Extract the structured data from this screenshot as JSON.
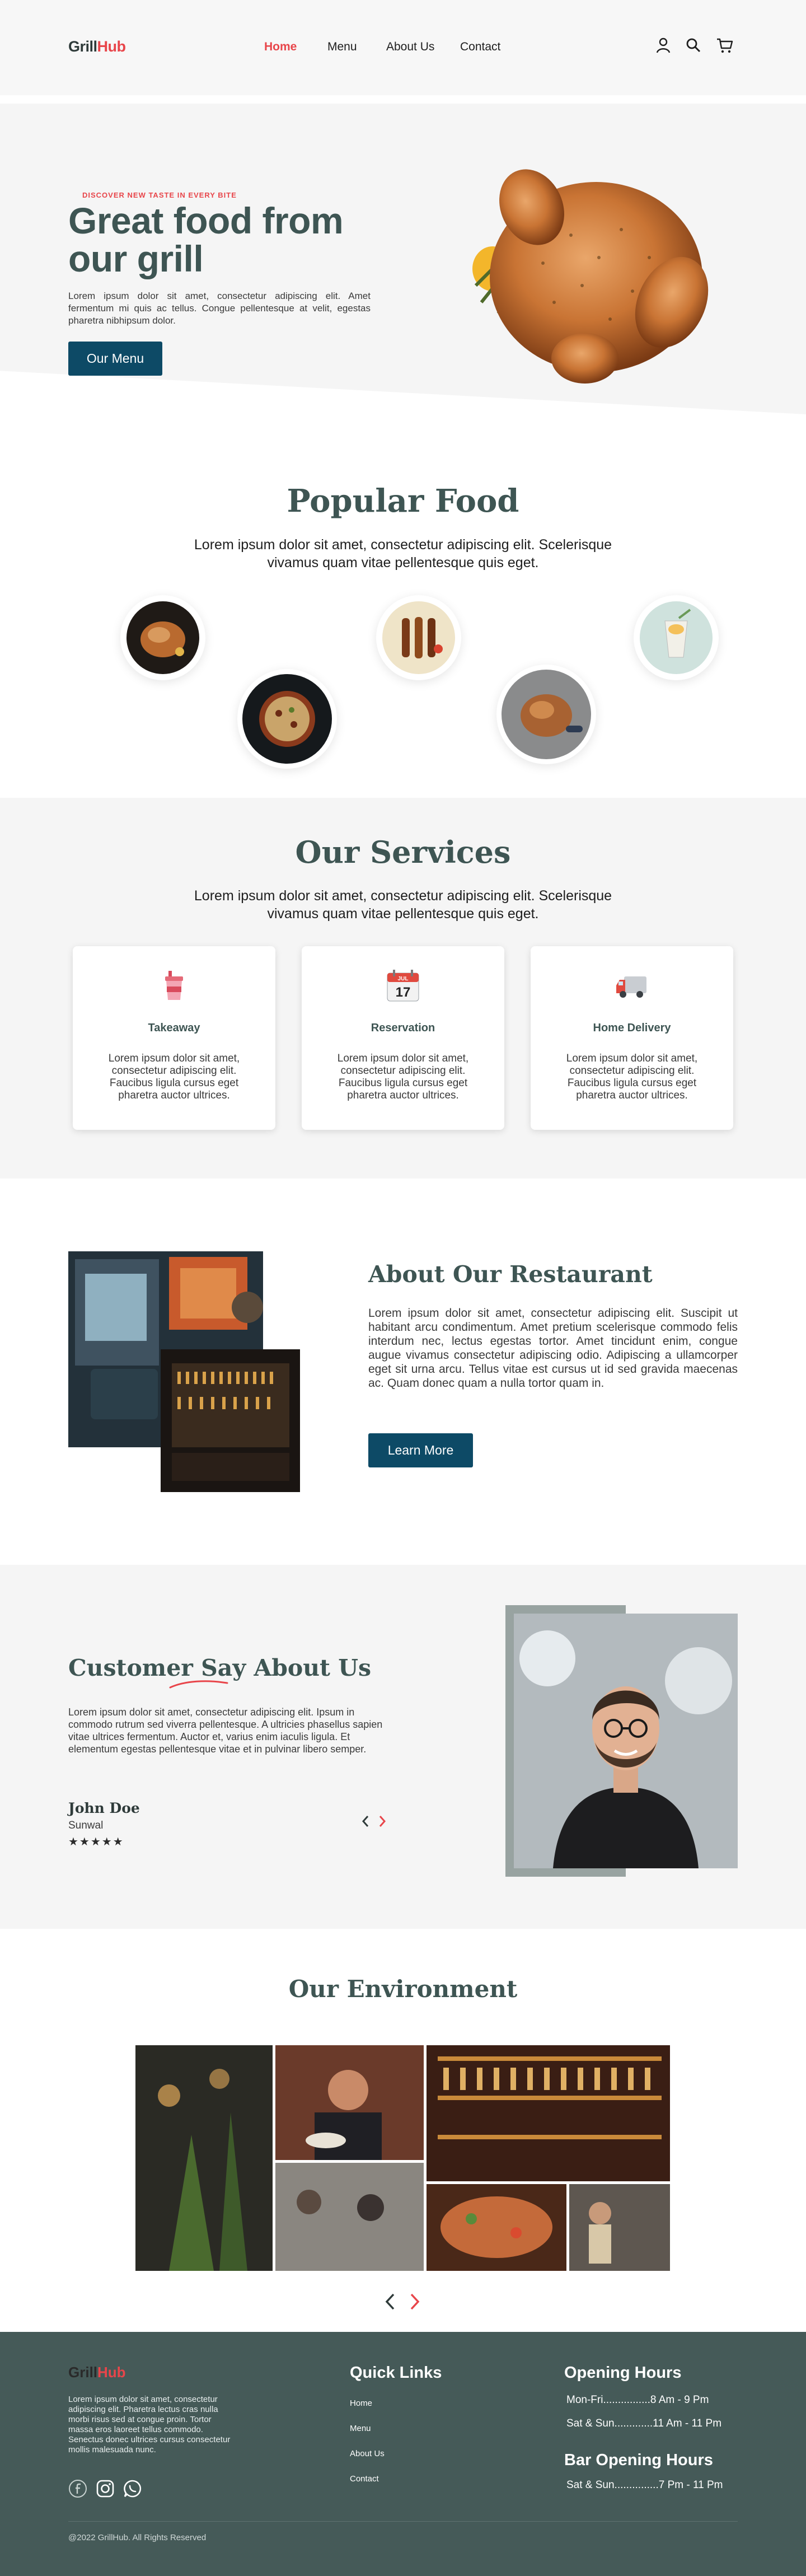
{
  "header": {
    "logo_a": "Grill",
    "logo_b": "Hub",
    "nav": [
      "Home",
      "Menu",
      "About Us",
      "Contact"
    ],
    "icons": [
      "user-icon",
      "search-icon",
      "cart-icon"
    ]
  },
  "hero": {
    "eyebrow": "DISCOVER NEW TASTE IN EVERY BITE",
    "title": "Great food from our grill",
    "text": "Lorem ipsum dolor sit amet, consectetur adipiscing elit. Amet fermentum mi quis ac tellus. Congue pellentesque at velit, egestas pharetra nibhipsum dolor.",
    "button": "Our Menu"
  },
  "popular": {
    "title": "Popular Food",
    "subtitle": "Lorem ipsum dolor sit amet, consectetur adipiscing elit. Scelerisque vivamus quam vitae pellentesque quis eget."
  },
  "services": {
    "title": "Our Services",
    "subtitle": "Lorem ipsum dolor sit amet, consectetur adipiscing elit. Scelerisque vivamus quam vitae pellentesque quis eget.",
    "cards": [
      {
        "title": "Takeaway",
        "text": "Lorem ipsum dolor sit amet, consectetur adipiscing elit. Faucibus ligula cursus eget pharetra auctor ultrices.",
        "icon": "takeaway-cup-icon"
      },
      {
        "title": "Reservation",
        "text": "Lorem ipsum dolor sit amet, consectetur adipiscing elit. Faucibus ligula cursus eget pharetra auctor ultrices.",
        "icon": "calendar-icon",
        "calendar_month": "JUL",
        "calendar_day": "17"
      },
      {
        "title": "Home Delivery",
        "text": "Lorem ipsum dolor sit amet, consectetur adipiscing elit. Faucibus ligula cursus eget pharetra auctor ultrices.",
        "icon": "delivery-truck-icon"
      }
    ]
  },
  "about": {
    "title": "About Our Restaurant",
    "text": "Lorem ipsum dolor sit amet, consectetur adipiscing elit. Suscipit ut habitant arcu condimentum. Amet pretium scelerisque commodo felis interdum nec, lectus egestas tortor. Amet tincidunt enim, congue augue vivamus consectetur adipiscing odio. Adipiscing a ullamcorper eget sit urna arcu. Tellus vitae est cursus ut id sed gravida maecenas ac. Quam donec quam a nulla tortor quam in.",
    "button": "Learn More"
  },
  "testimonial": {
    "title": "Customer Say About Us",
    "text": "Lorem ipsum dolor sit amet, consectetur adipiscing elit. Ipsum in commodo rutrum sed viverra pellentesque. A ultricies phasellus sapien vitae ultrices fermentum. Auctor et, varius enim iaculis ligula. Et elementum egestas pellentesque vitae et in pulvinar libero semper.",
    "name": "John Doe",
    "location": "Sunwal",
    "stars": "★★★★★",
    "rating": 5
  },
  "environment": {
    "title": "Our Environment"
  },
  "footer": {
    "logo_a": "Grill",
    "logo_b": "Hub",
    "text": "Lorem ipsum dolor sit amet, consectetur adipiscing elit. Pharetra lectus cras nulla morbi risus sed at congue proin. Tortor massa eros laoreet tellus commodo. Senectus donec ultrices cursus consectetur mollis malesuada nunc.",
    "quick_links_title": "Quick Links",
    "links": [
      "Home",
      "Menu",
      "About Us",
      "Contact"
    ],
    "opening_title": "Opening Hours",
    "opening": [
      "Mon-Fri................8 Am - 9 Pm",
      "Sat & Sun.............11 Am - 11 Pm"
    ],
    "bar_title": "Bar Opening Hours",
    "bar": [
      "Sat & Sun...............7 Pm - 11 Pm"
    ],
    "copyright": "@2022 GrillHub. All Rights Reserved",
    "social": [
      "facebook-icon",
      "instagram-icon",
      "whatsapp-icon"
    ]
  },
  "colors": {
    "accent": "#e8454a",
    "heading": "#3e5553",
    "button": "#0d4a66",
    "footer": "#455a58"
  }
}
